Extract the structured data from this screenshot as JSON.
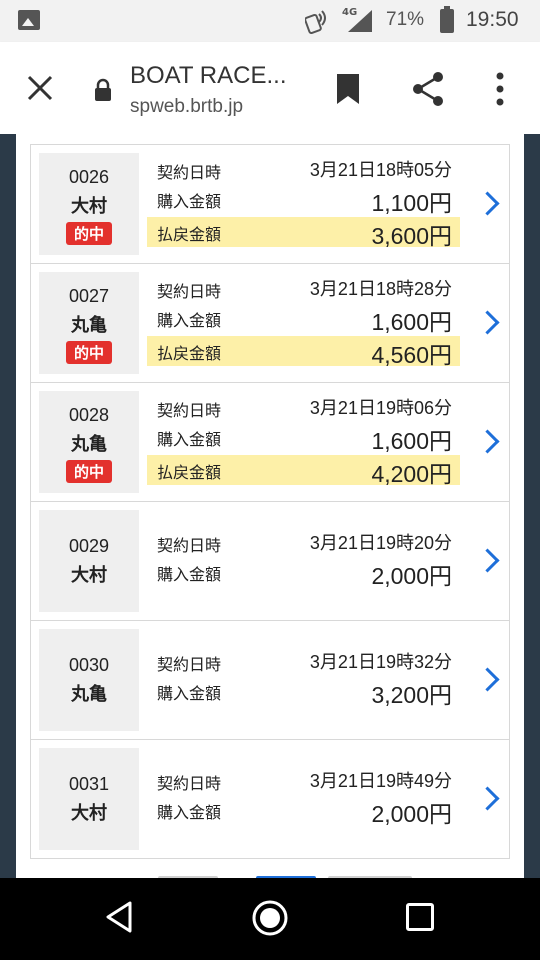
{
  "status_bar": {
    "network": "4G",
    "battery_percent": "71%",
    "time": "19:50"
  },
  "browser": {
    "title": "BOAT RACE...",
    "url": "spweb.brtb.jp"
  },
  "labels": {
    "contract_datetime": "契約日時",
    "purchase_amount": "購入金額",
    "payout_amount": "払戻金額",
    "hit_badge": "的中"
  },
  "rows": [
    {
      "number": "0026",
      "venue": "大村",
      "hit": true,
      "datetime": "3月21日18時05分",
      "purchase": "1,100円",
      "payout": "3,600円"
    },
    {
      "number": "0027",
      "venue": "丸亀",
      "hit": true,
      "datetime": "3月21日18時28分",
      "purchase": "1,600円",
      "payout": "4,560円"
    },
    {
      "number": "0028",
      "venue": "丸亀",
      "hit": true,
      "datetime": "3月21日19時06分",
      "purchase": "1,600円",
      "payout": "4,200円"
    },
    {
      "number": "0029",
      "venue": "大村",
      "hit": false,
      "datetime": "3月21日19時20分",
      "purchase": "2,000円"
    },
    {
      "number": "0030",
      "venue": "丸亀",
      "hit": false,
      "datetime": "3月21日19時32分",
      "purchase": "3,200円"
    },
    {
      "number": "0031",
      "venue": "大村",
      "hit": false,
      "datetime": "3月21日19時49分",
      "purchase": "2,000円"
    }
  ],
  "colors": {
    "hit_badge": "#e3312d",
    "payout_highlight": "#fdf0a8",
    "chevron": "#1e6fd9"
  }
}
